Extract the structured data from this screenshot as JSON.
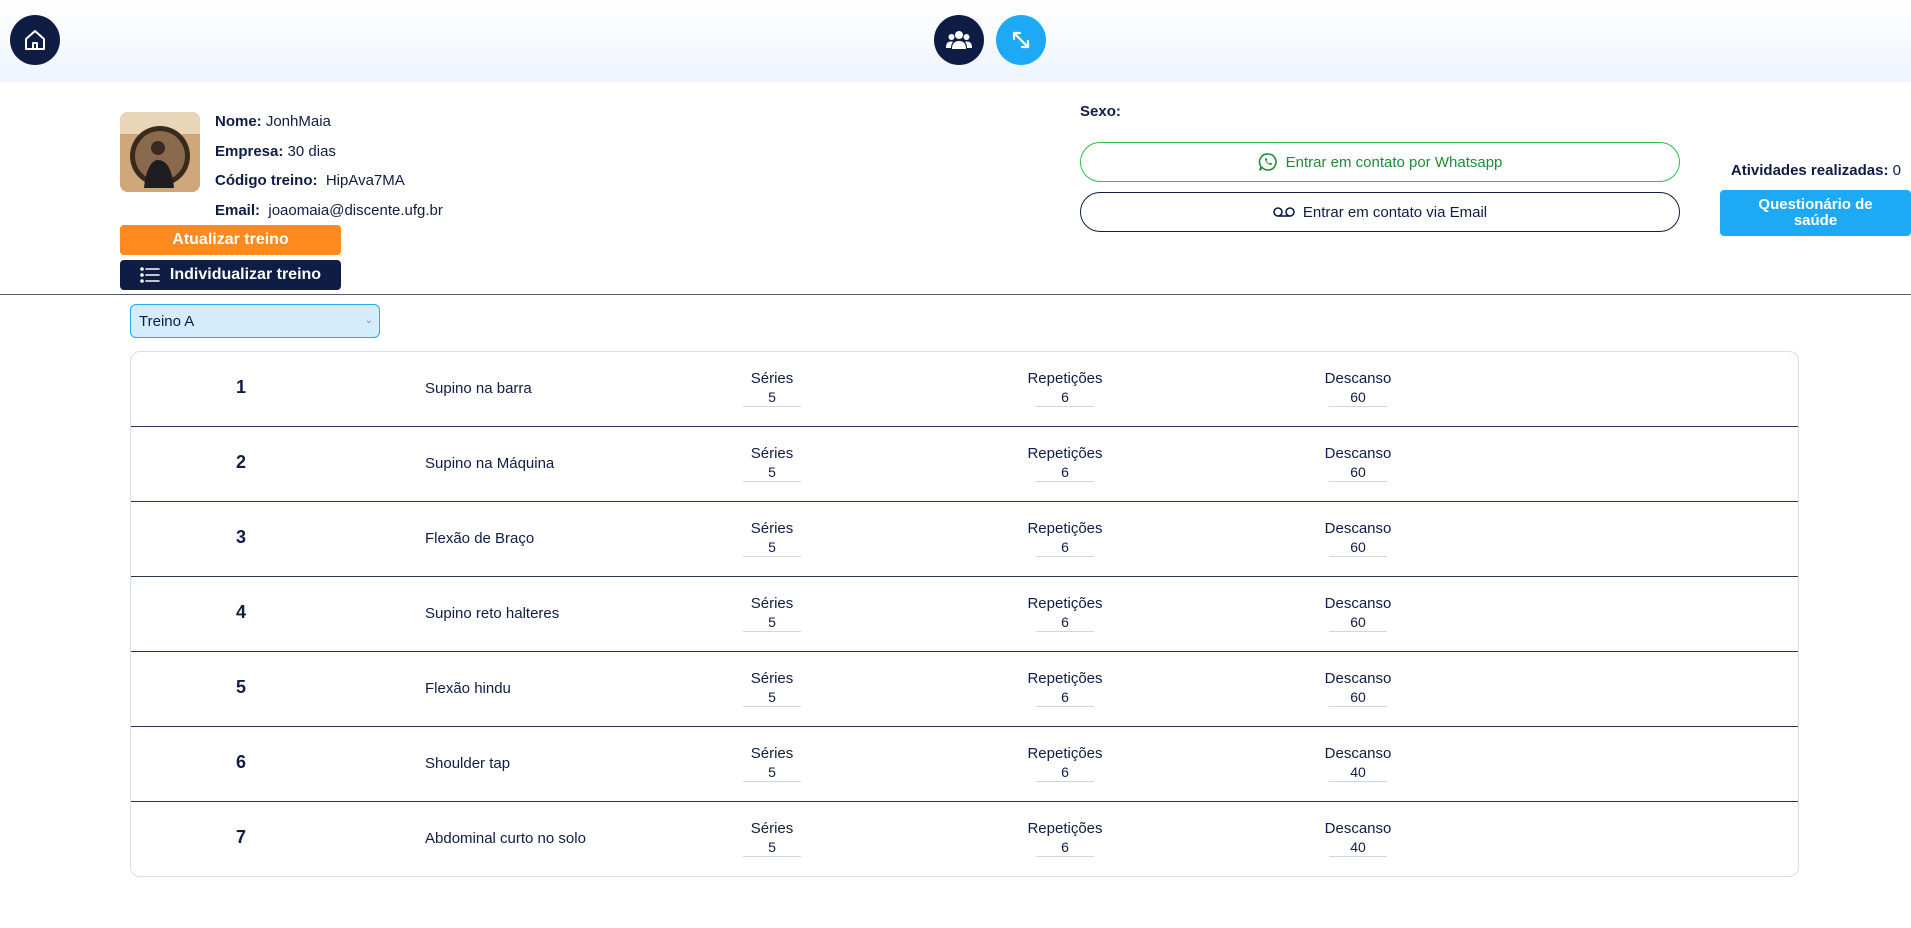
{
  "nav": {
    "home_icon": "home-icon",
    "users_icon": "users-icon",
    "expand_icon": "expand-icon"
  },
  "profile": {
    "name_label": "Nome:",
    "name_value": "JonhMaia",
    "company_label": "Empresa:",
    "company_value": "30 dias",
    "code_label": "Código treino:",
    "code_value": "HipAva7MA",
    "email_label": "Email:",
    "email_value": "joaomaia@discente.ufg.br"
  },
  "actions": {
    "update_label": "Atualizar treino",
    "individualize_label": "Individualizar treino"
  },
  "contact": {
    "sexo_label": "Sexo:",
    "whatsapp_label": "Entrar em contato por Whatsapp",
    "email_label": "Entrar em contato via Email"
  },
  "stats": {
    "activities_label": "Atividades realizadas:",
    "activities_value": "0",
    "questionnaire_label": "Questionário de saúde"
  },
  "workout_select": {
    "selected": "Treino A"
  },
  "labels": {
    "series": "Séries",
    "reps": "Repetições",
    "rest": "Descanso"
  },
  "exercises": [
    {
      "num": "1",
      "name": "Supino na barra",
      "series": "5",
      "reps": "6",
      "rest": "60"
    },
    {
      "num": "2",
      "name": "Supino na Máquina",
      "series": "5",
      "reps": "6",
      "rest": "60"
    },
    {
      "num": "3",
      "name": "Flexão de Braço",
      "series": "5",
      "reps": "6",
      "rest": "60"
    },
    {
      "num": "4",
      "name": "Supino reto halteres",
      "series": "5",
      "reps": "6",
      "rest": "60"
    },
    {
      "num": "5",
      "name": "Flexão hindu",
      "series": "5",
      "reps": "6",
      "rest": "60"
    },
    {
      "num": "6",
      "name": "Shoulder tap",
      "series": "5",
      "reps": "6",
      "rest": "40"
    },
    {
      "num": "7",
      "name": "Abdominal curto no solo",
      "series": "5",
      "reps": "6",
      "rest": "40"
    }
  ]
}
